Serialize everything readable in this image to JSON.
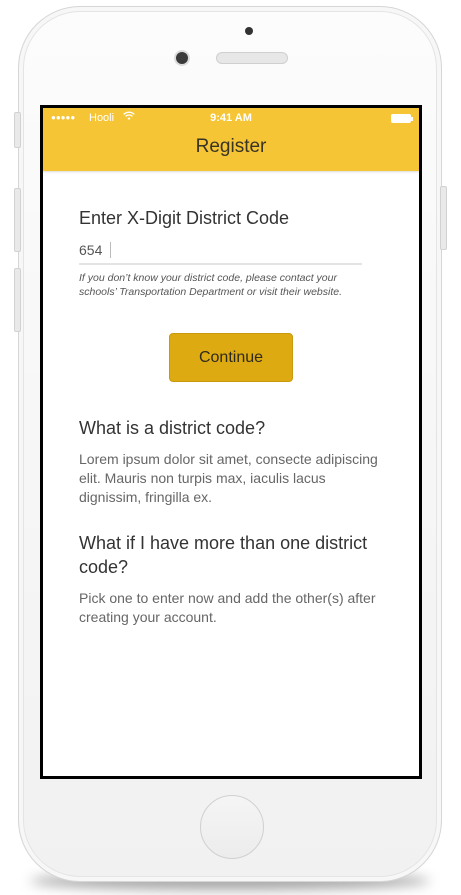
{
  "status_bar": {
    "signal": "●●●●●",
    "carrier": "Hooli",
    "wifi_icon": "wifi-icon",
    "time": "9:41 AM",
    "battery_icon": "battery-icon"
  },
  "header": {
    "title": "Register",
    "color": "#f5c536"
  },
  "form": {
    "label": "Enter X-Digit District Code",
    "input_value": "654",
    "hint": "If you don’t know your district code, please contact your schools’ Transportation Department or visit their website.",
    "continue_label": "Continue",
    "button_color": "#ddaa12"
  },
  "faq": [
    {
      "question": "What is a district code?",
      "answer": "Lorem ipsum dolor sit amet, consecte adipiscing elit. Mauris non turpis max, iaculis lacus dignissim, fringilla ex."
    },
    {
      "question": "What if I have more than one district code?",
      "answer": "Pick one to enter now and add the other(s) after creating your account."
    }
  ]
}
